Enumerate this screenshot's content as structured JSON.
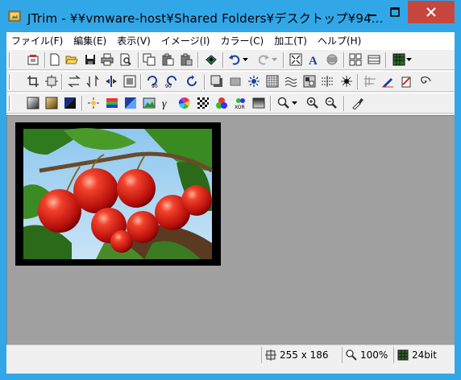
{
  "window": {
    "title": "JTrim - ¥¥vmware-host¥Shared Folders¥デスクトップ¥94...",
    "accent_color": "#32a7e8",
    "close_color": "#c7463d",
    "icons": {
      "app": "jtrim-app-icon",
      "minimize": "minimize-icon",
      "maximize": "maximize-icon",
      "close": "close-icon"
    }
  },
  "menu": {
    "items": [
      "ファイル(F)",
      "編集(E)",
      "表示(V)",
      "イメージ(I)",
      "カラー(C)",
      "加工(T)",
      "ヘルプ(H)"
    ]
  },
  "toolbar": {
    "row1": [
      "print-setup-icon",
      "new-icon",
      "open-icon",
      "save-icon",
      "print-icon",
      "print-preview-icon",
      "copy-icon",
      "paste-icon",
      "paste-new-icon",
      "capture-icon",
      "undo-icon",
      "redo-icon",
      "fit-window-icon",
      "text-icon",
      "resize-icon",
      "thumbnail-icon",
      "filmstrip-icon",
      "palette-icon"
    ],
    "row2": [
      "crop-icon",
      "resize-canvas-icon",
      "flip-horizontal-icon",
      "flip-vertical-icon",
      "mirror-icon",
      "frame-icon",
      "rotate-left-90-icon",
      "rotate-right-90-icon",
      "rotate-free-icon",
      "shadow-icon",
      "bevel-icon",
      "sunburst-icon",
      "mosaic-icon",
      "wave-icon",
      "emboss-icon",
      "edge-icon",
      "noise-icon",
      "blur-icon",
      "pen-icon",
      "eraser-icon",
      "swirl-icon"
    ],
    "row3": [
      "grayscale-icon",
      "sepia-icon",
      "negative-icon",
      "brightness-icon",
      "color-balance-icon",
      "hue-icon",
      "image-icon",
      "gamma-icon",
      "color-wheel-icon",
      "checker-icon",
      "rgb-icon",
      "xor-icon",
      "gradient-icon",
      "search-zoom-icon",
      "zoom-in-icon",
      "zoom-out-icon",
      "eyedropper-icon"
    ]
  },
  "canvas": {
    "background": "#a0a0a0",
    "image_alt": "cherries photo"
  },
  "status": {
    "size": "255 x 186",
    "zoom": "100%",
    "depth": "24bit"
  }
}
